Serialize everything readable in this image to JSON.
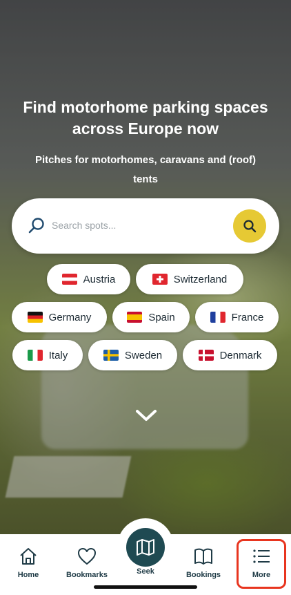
{
  "hero": {
    "title_line1": "Find motorhome parking spaces",
    "title_line2": "across Europe now",
    "subtitle_line1": "Pitches for motorhomes, caravans and (roof)",
    "subtitle_line2": "tents"
  },
  "search": {
    "placeholder": "Search spots...",
    "accent": "#e6c934"
  },
  "countries": [
    {
      "label": "Austria",
      "flag": "austria-flag-icon"
    },
    {
      "label": "Switzerland",
      "flag": "switzerland-flag-icon"
    },
    {
      "label": "Germany",
      "flag": "germany-flag-icon"
    },
    {
      "label": "Spain",
      "flag": "spain-flag-icon"
    },
    {
      "label": "France",
      "flag": "france-flag-icon"
    },
    {
      "label": "Italy",
      "flag": "italy-flag-icon"
    },
    {
      "label": "Sweden",
      "flag": "sweden-flag-icon"
    },
    {
      "label": "Denmark",
      "flag": "denmark-flag-icon"
    }
  ],
  "nav": {
    "items": [
      {
        "label": "Home",
        "icon": "home-icon"
      },
      {
        "label": "Bookmarks",
        "icon": "heart-icon"
      },
      {
        "label": "Seek",
        "icon": "map-icon"
      },
      {
        "label": "Bookings",
        "icon": "book-icon"
      },
      {
        "label": "More",
        "icon": "list-icon"
      }
    ],
    "highlight_color": "#e8351f",
    "primary_color": "#1f4a52"
  }
}
